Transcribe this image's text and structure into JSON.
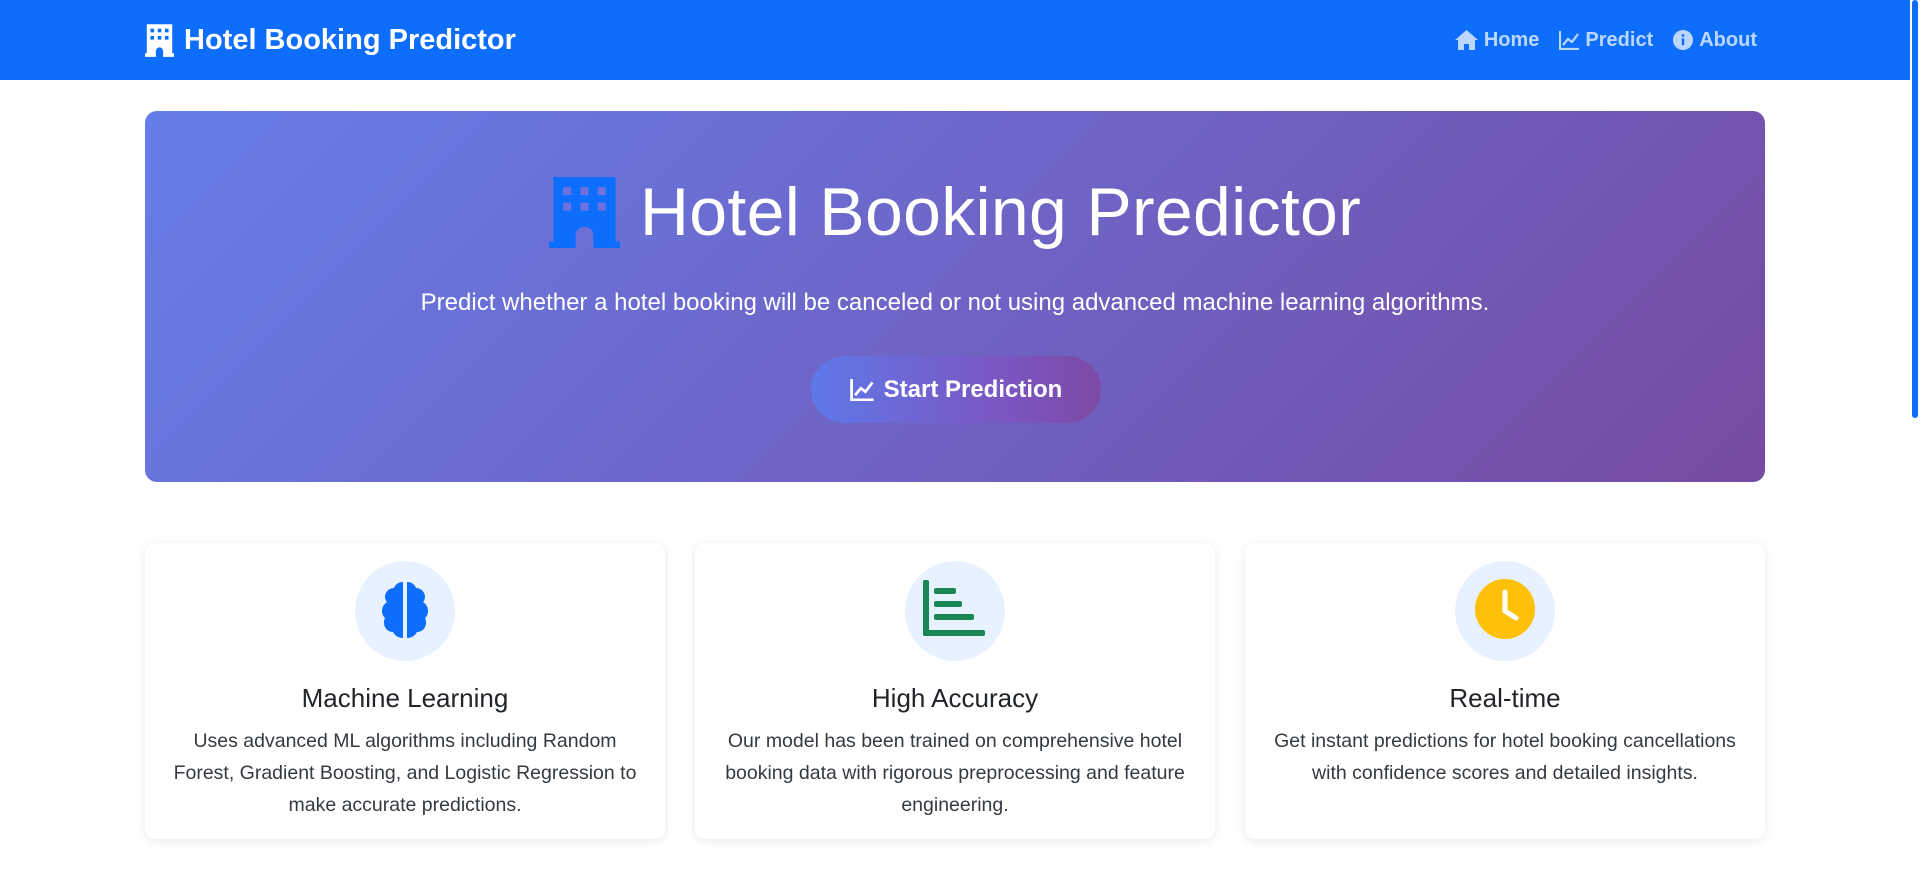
{
  "navbar": {
    "brand": "Hotel Booking Predictor",
    "brand_icon": "building-icon",
    "links": [
      {
        "label": "Home",
        "icon": "house-icon"
      },
      {
        "label": "Predict",
        "icon": "line-chart-icon"
      },
      {
        "label": "About",
        "icon": "info-circle-icon"
      }
    ],
    "color": "#0d6efd"
  },
  "hero": {
    "title": "Hotel Booking Predictor",
    "title_icon": "building-icon",
    "subtitle": "Predict whether a hotel booking will be canceled or not using advanced machine learning algorithms.",
    "button_label": "Start Prediction",
    "button_icon": "line-chart-icon",
    "gradient_start": "#667eea",
    "gradient_end": "#764ba2"
  },
  "features": [
    {
      "title": "Machine Learning",
      "text": "Uses advanced ML algorithms including Random Forest, Gradient Boosting, and Logistic Regression to make accurate predictions.",
      "icon": "brain-icon",
      "icon_color": "#0d6efd"
    },
    {
      "title": "High Accuracy",
      "text": "Our model has been trained on comprehensive hotel booking data with rigorous preprocessing and feature engineering.",
      "icon": "bar-chart-steps-icon",
      "icon_color": "#198754"
    },
    {
      "title": "Real-time",
      "text": "Get instant predictions for hotel booking cancellations with confidence scores and detailed insights.",
      "icon": "clock-icon",
      "icon_color": "#ffc107"
    }
  ]
}
